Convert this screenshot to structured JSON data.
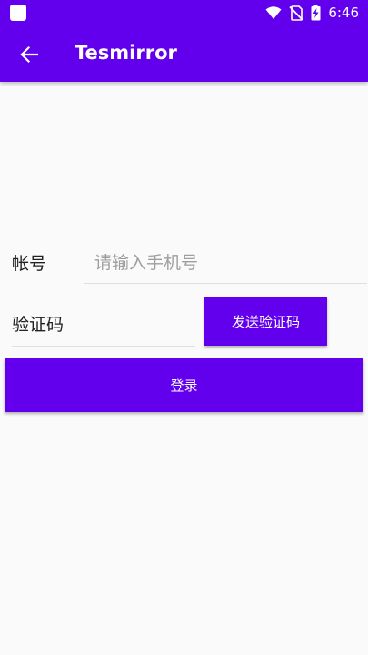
{
  "status_bar": {
    "time": "6:46",
    "icons": [
      "app-notification-icon",
      "wifi-icon",
      "no-sim-icon",
      "battery-charging-icon"
    ]
  },
  "toolbar": {
    "title": "Tesmirror",
    "back_icon": "arrow-left-icon"
  },
  "form": {
    "account_label": "帐号",
    "account_placeholder": "请输入手机号",
    "code_label": "验证码",
    "send_code_label": "发送验证码",
    "login_label": "登录"
  },
  "colors": {
    "primary": "#6200ee",
    "background": "#fafafa",
    "on_primary": "#ffffff"
  }
}
